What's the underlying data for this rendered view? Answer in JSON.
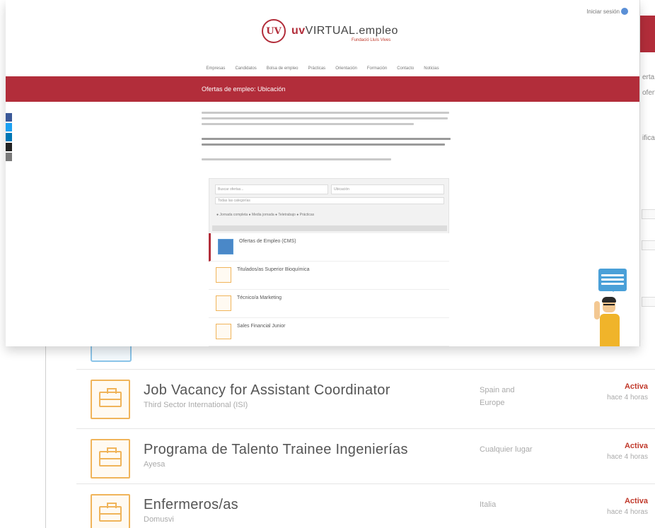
{
  "site": {
    "header_link": "Iniciar sesión",
    "logo_mark": "UV",
    "logo_word_bold": "uv",
    "logo_word_light": "VIRTUAL.empleo",
    "logo_sub": "Fundació Lluís Vives",
    "nav": [
      "Empresas",
      "Candidatos",
      "Bolsa de empleo",
      "Prácticas",
      "Orientación",
      "Formación",
      "Contacto",
      "Noticias"
    ],
    "banner_title": "Ofertas de empleo: Ubicación"
  },
  "search": {
    "keyword_placeholder": "Buscar ofertas...",
    "location_placeholder": "Ubicación",
    "category_placeholder": "Todas las categorías",
    "filters": "● Jornada completa   ● Media jornada   ● Teletrabajo   ● Prácticas"
  },
  "preview_jobs": [
    {
      "title": "Ofertas de Empleo (CMS)",
      "company": "",
      "place": "",
      "status": "",
      "blue": true
    },
    {
      "title": "Titulados/as Superior Bioquímica",
      "company": "",
      "place": "",
      "status": "",
      "blue": false
    },
    {
      "title": "Técnico/a Marketing",
      "company": "",
      "place": "",
      "status": "",
      "blue": false
    },
    {
      "title": "Sales Financial Junior",
      "company": "",
      "place": "",
      "status": "",
      "blue": false
    }
  ],
  "jobs": [
    {
      "title": "Job Vacancy for Assistant Coordinator",
      "company": "Third Sector International (ISI)",
      "place": "Spain and Europe",
      "status": "Activa",
      "ago": "hace 4 horas"
    },
    {
      "title": "Programa de Talento Trainee Ingenierías",
      "company": "Ayesa",
      "place": "Cualquier lugar",
      "status": "Activa",
      "ago": "hace 4 horas"
    },
    {
      "title": "Enfermeros/as",
      "company": "Domusvi",
      "place": "Italia",
      "status": "Activa",
      "ago": "hace 4 horas"
    }
  ],
  "right_sliver": {
    "lines": [
      "erta",
      "ofert",
      "ifica"
    ]
  },
  "colors": {
    "brand_red": "#b22d3a",
    "accent_orange": "#f0b45a",
    "accent_blue": "#4aa0d8",
    "status_red": "#c0392b"
  },
  "social_colors": [
    "#3b5998",
    "#1da1f2",
    "#0077b5",
    "#222222",
    "#7a7a7a"
  ]
}
